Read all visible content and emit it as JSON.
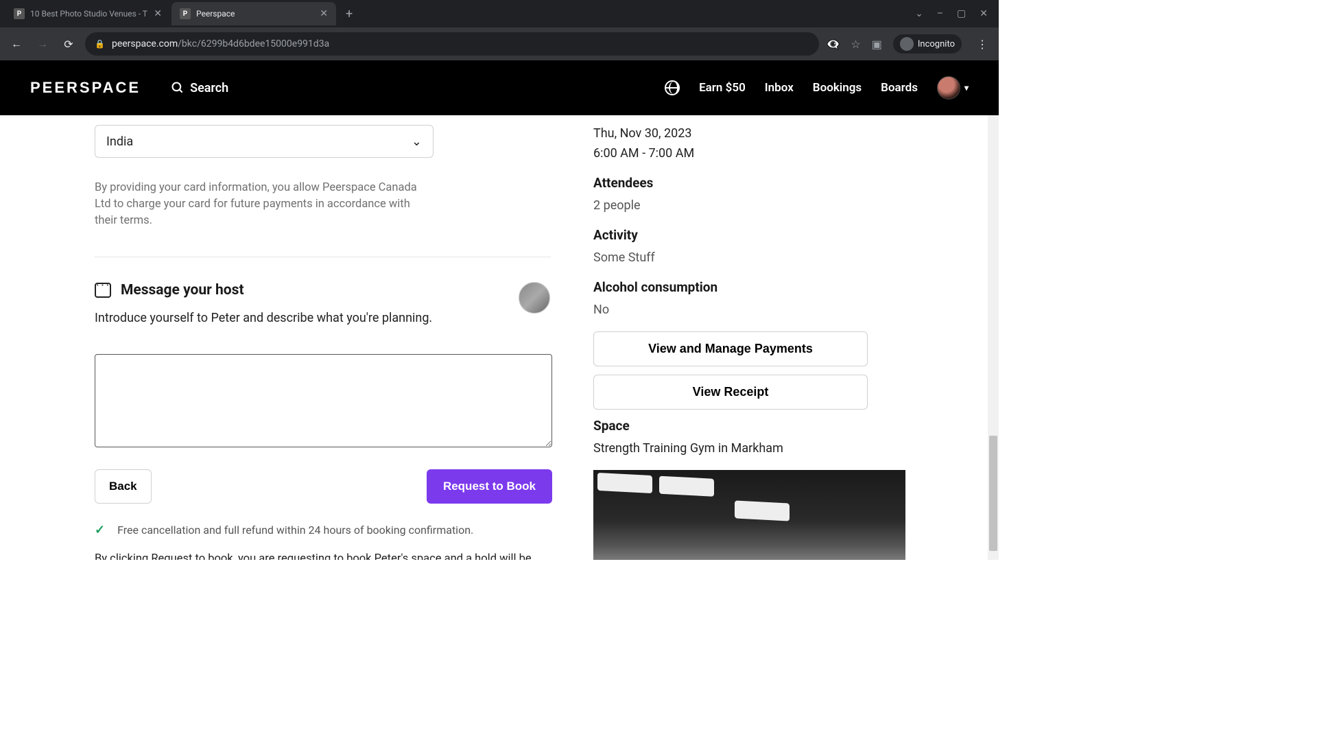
{
  "browser": {
    "tabs": [
      {
        "title": "10 Best Photo Studio Venues - T",
        "favicon": "P"
      },
      {
        "title": "Peerspace",
        "favicon": "P"
      }
    ],
    "window_controls": {
      "minimize": "–",
      "maximize": "▢",
      "close": "✕"
    },
    "url": {
      "lock": "🔒",
      "domain": "peerspace.com",
      "path": "/bkc/6299b4d6bdee15000e991d3a"
    },
    "incognito": "Incognito"
  },
  "nav": {
    "logo": "PEERSPACE",
    "search": "Search",
    "earn": "Earn $50",
    "inbox": "Inbox",
    "bookings": "Bookings",
    "boards": "Boards"
  },
  "form": {
    "country": "India",
    "disclosure": "By providing your card information, you allow Peerspace Canada Ltd to charge your card for future payments in accordance with their terms.",
    "message_title": "Message your host",
    "message_subtitle": "Introduce yourself to Peter and describe what you're planning.",
    "back": "Back",
    "request": "Request to Book",
    "cancellation": "Free cancellation and full refund within 24 hours of booking confirmation.",
    "terms": "By clicking Request to book, you are requesting to book Peter's space and a hold will be placed on your card. If Peter accepts, your booking will be confirmed and your card will be charged."
  },
  "summary": {
    "date_line1": "Thu, Nov 30, 2023",
    "date_line2": "6:00 AM - 7:00 AM",
    "attendees_label": "Attendees",
    "attendees_value": "2 people",
    "activity_label": "Activity",
    "activity_value": "Some Stuff",
    "alcohol_label": "Alcohol consumption",
    "alcohol_value": "No",
    "view_payments": "View and Manage Payments",
    "view_receipt": "View Receipt",
    "space_label": "Space",
    "space_value": "Strength Training Gym in Markham"
  }
}
